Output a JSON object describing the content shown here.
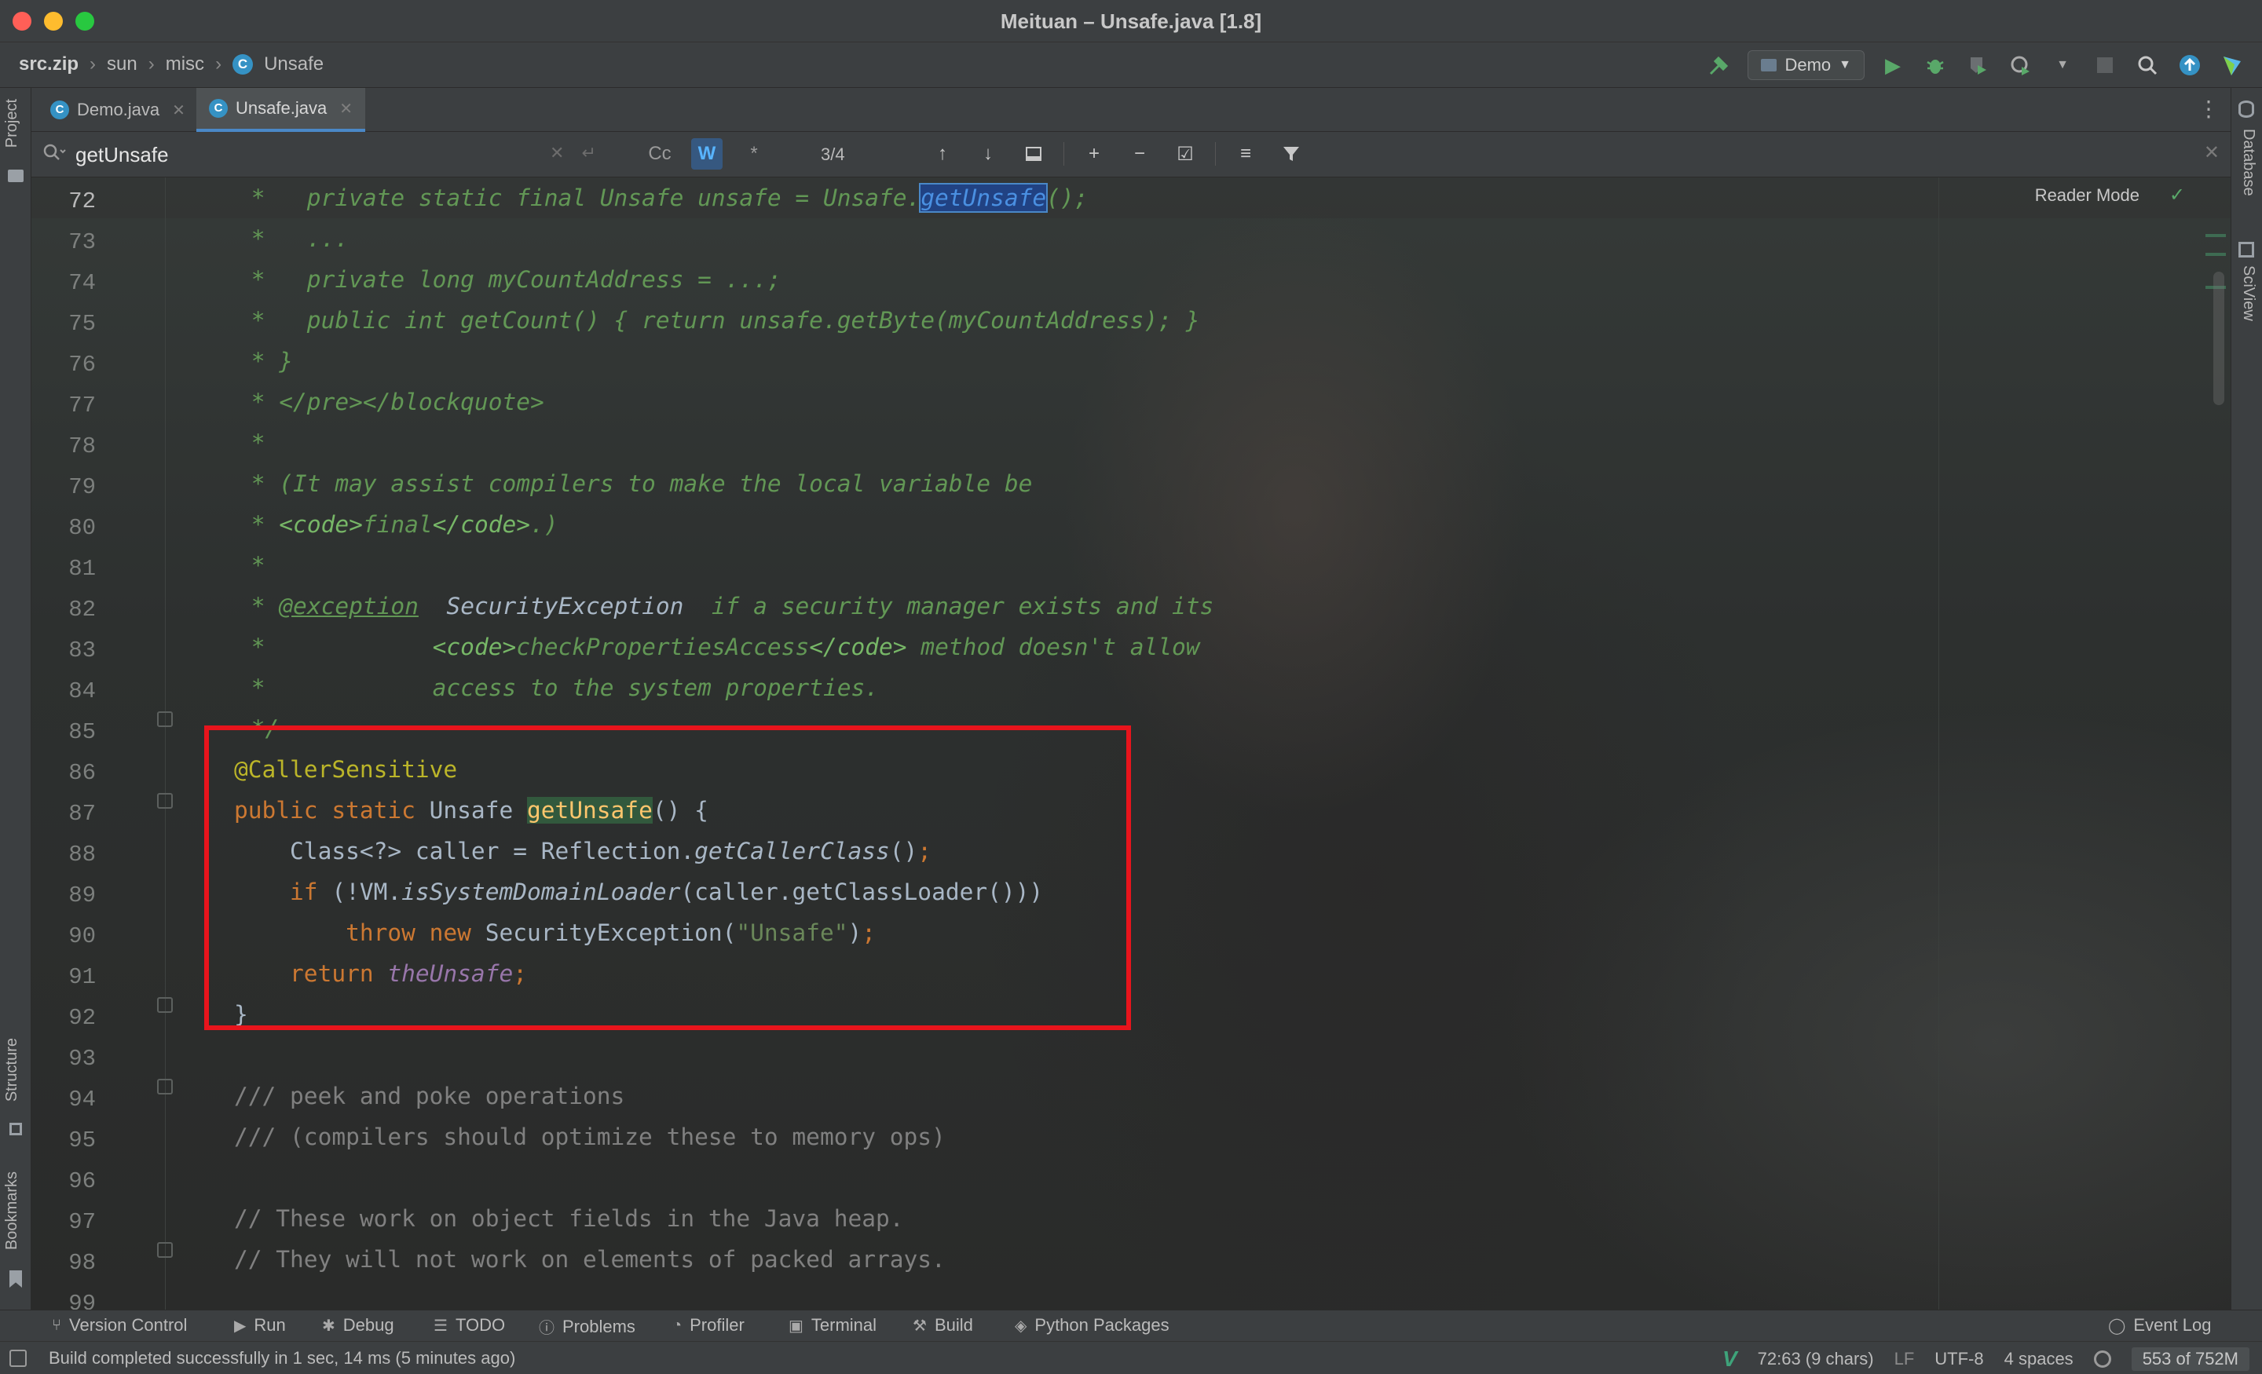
{
  "window": {
    "title": "Meituan – Unsafe.java [1.8]"
  },
  "breadcrumb": {
    "items": [
      "src.zip",
      "sun",
      "misc",
      "Unsafe"
    ],
    "class_icon": "C"
  },
  "run_config": {
    "label": "Demo"
  },
  "tabs": [
    {
      "label": "Demo.java",
      "active": false
    },
    {
      "label": "Unsafe.java",
      "active": true
    }
  ],
  "find": {
    "query": "getUnsafe",
    "match_count": "3/4",
    "words_toggle": "W",
    "case_toggle": "Cc",
    "regex_toggle": "*"
  },
  "editor": {
    "reader_mode": "Reader Mode",
    "line_numbers": [
      "72",
      "73",
      "74",
      "75",
      "76",
      "77",
      "78",
      "79",
      "80",
      "81",
      "82",
      "83",
      "84",
      "85",
      "86",
      "87",
      "88",
      "89",
      "90",
      "91",
      "92",
      "93",
      "94",
      "95",
      "96",
      "97",
      "98",
      "99"
    ],
    "lines": {
      "l72_a": " *   private static final Unsafe unsafe = Unsafe.",
      "l72_hit": "getUnsafe",
      "l72_b": "();",
      "l73": " *   ...",
      "l74": " *   private long myCountAddress = ...;",
      "l75": " *   public int getCount() { return unsafe.getByte(myCountAddress); }",
      "l76": " * }",
      "l77": " * </pre></blockquote>",
      "l78": " *",
      "l79": " * (It may assist compilers to make the local variable be",
      "l80_a": " * ",
      "l80_b": "<code>",
      "l80_c": "final",
      "l80_d": "</code>",
      "l80_e": ".)",
      "l81": " *",
      "l82_a": " * ",
      "l82_b": "@exception",
      "l82_c": "  SecurityException",
      "l82_d": "  if a security manager exists and its",
      "l83_a": " *            ",
      "l83_b": "<code>",
      "l83_c": "checkPropertiesAccess",
      "l83_d": "</code>",
      "l83_e": " method doesn't allow",
      "l84": " *            access to the system properties.",
      "l85": " */",
      "l86": "@CallerSensitive",
      "l87_kw": "public static",
      "l87_type": " Unsafe ",
      "l87_fn": "getUnsafe",
      "l87_end": "() {",
      "l88_a": "    Class<?> caller = Reflection.",
      "l88_b": "getCallerClass",
      "l88_c": "()",
      "l88_d": ";",
      "l89_kw": "    if",
      "l89_a": " (!VM.",
      "l89_b": "isSystemDomainLoader",
      "l89_c": "(caller.getClassLoader()))",
      "l90_kw": "        throw new",
      "l90_a": " SecurityException(",
      "l90_str": "\"Unsafe\"",
      "l90_b": ")",
      "l90_c": ";",
      "l91_kw": "    return",
      "l91_fld": " theUnsafe",
      "l91_c": ";",
      "l92": "}",
      "l93": "",
      "l94": "/// peek and poke operations",
      "l95": "/// (compilers should optimize these to memory ops)",
      "l96": "",
      "l97": "// These work on object fields in the Java heap.",
      "l98": "// They will not work on elements of packed arrays.",
      "l99": ""
    }
  },
  "left_tools": [
    "Project",
    "Structure",
    "Bookmarks"
  ],
  "right_tools": [
    "Database",
    "SciView"
  ],
  "bottom_tools": [
    "Version Control",
    "Run",
    "Debug",
    "TODO",
    "Problems",
    "Profiler",
    "Terminal",
    "Build",
    "Python Packages"
  ],
  "event_log": "Event Log",
  "status": {
    "message": "Build completed successfully in 1 sec, 14 ms (5 minutes ago)",
    "position": "72:63 (9 chars)",
    "line_sep": "LF",
    "encoding": "UTF-8",
    "indent": "4 spaces",
    "memory": "553 of 752M"
  },
  "colors": {
    "accent": "#4a88c7",
    "highlight_box": "#e8141c",
    "keyword": "#cc7832",
    "comment": "#629755",
    "function": "#ffc66d"
  }
}
